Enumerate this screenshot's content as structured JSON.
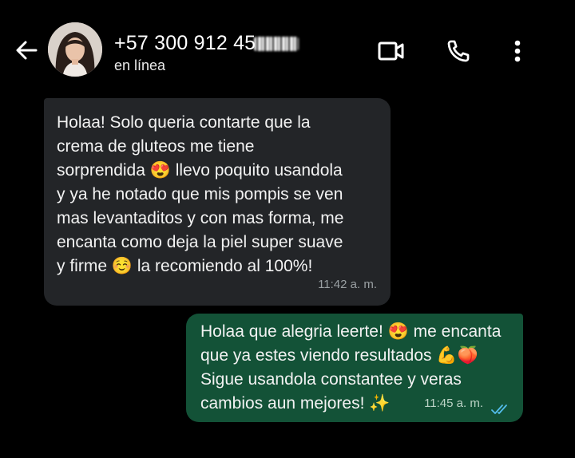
{
  "header": {
    "contact_name": "+57 300 912 45",
    "status": "en línea",
    "icons": {
      "back": "arrow-left-icon",
      "video": "video-camera-icon",
      "call": "phone-icon",
      "menu": "more-vertical-icon"
    }
  },
  "messages": [
    {
      "direction": "incoming",
      "lines": [
        "Holaa! Solo queria contarte que la",
        "crema de gluteos me tiene",
        "sorprendida 😍 llevo poquito usandola",
        "y ya he notado que mis pompis se ven",
        "mas levantaditos y con mas forma, me",
        "encanta como deja la piel super suave",
        "y firme ☺️ la recomiendo al 100%!"
      ],
      "time": "11:42 a. m."
    },
    {
      "direction": "outgoing",
      "lines": [
        "Holaa que alegria leerte! 😍 me encanta",
        "que ya estes viendo resultados 💪🍑",
        "Sigue usandola constantee y veras",
        "cambios aun mejores! ✨"
      ],
      "time": "11:45 a. m.",
      "read_receipt": "double-check-icon"
    }
  ],
  "colors": {
    "background": "#000000",
    "incoming_bubble": "#232528",
    "outgoing_bubble": "#135237",
    "read_tick": "#53bdeb"
  }
}
